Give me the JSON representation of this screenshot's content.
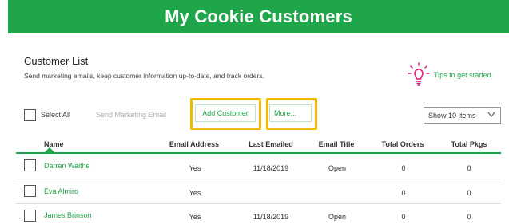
{
  "header": {
    "title": "My Cookie Customers"
  },
  "section": {
    "title": "Customer List",
    "subtitle": "Send marketing emails, keep customer information up-to-date, and track orders."
  },
  "tips": {
    "label": "Tips to get started",
    "icon": "lightbulb-icon",
    "color": "#e6197a"
  },
  "toolbar": {
    "select_all": "Select All",
    "send_email": "Send Marketing Email",
    "add_customer": "Add Customer",
    "more": "More...",
    "show_items": "Show 10 Items"
  },
  "table": {
    "columns": [
      "Name",
      "Email Address",
      "Last Emailed",
      "Email Title",
      "Total Orders",
      "Total Pkgs"
    ],
    "rows": [
      {
        "name": "Darren Waithe",
        "email": "Yes",
        "last_emailed": "11/18/2019",
        "title": "Open",
        "orders": "0",
        "pkgs": "0"
      },
      {
        "name": "Eva Almiro",
        "email": "Yes",
        "last_emailed": "",
        "title": "",
        "orders": "0",
        "pkgs": "0"
      },
      {
        "name": "James Brinson",
        "email": "Yes",
        "last_emailed": "11/18/2019",
        "title": "Open",
        "orders": "0",
        "pkgs": "0"
      }
    ]
  },
  "colors": {
    "brand": "#1fa64a",
    "highlight": "#f5b800"
  }
}
